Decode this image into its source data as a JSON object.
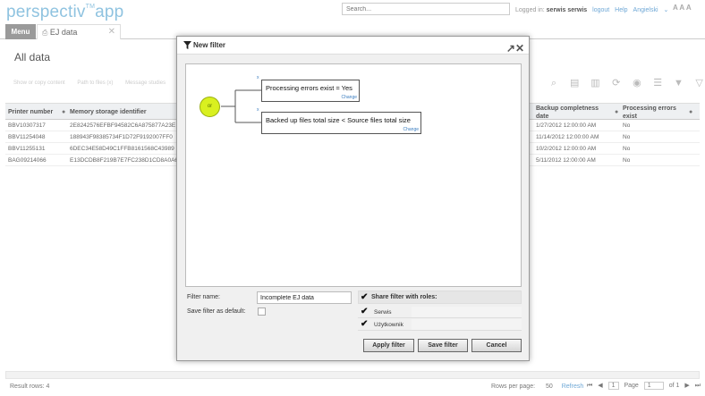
{
  "header": {
    "logo_text": "perspectiv",
    "logo_tm": "TM",
    "logo_app": "app",
    "search_placeholder": "Search...",
    "logged_in_label": "Logged in:",
    "user": "serwis serwis",
    "logout": "logout",
    "help": "Help",
    "language": "Angielski",
    "font_sizes": "A A A"
  },
  "tabs": {
    "menu_label": "Menu",
    "ej_tab_label": "EJ data",
    "close_glyph": "✕"
  },
  "page": {
    "title": "All data",
    "toolbar_links": [
      "Show or copy content",
      "Path to files (x)",
      "Message studies"
    ]
  },
  "grid": {
    "columns": [
      "Printer number",
      "Memory storage identifier",
      "Backup completness date",
      "Processing errors exist"
    ],
    "rows": [
      {
        "printer": "BBV10307317",
        "memory": "2E8242576EFBF94582C6A875877A23E",
        "date": "1/27/2012 12:00:00 AM",
        "errors": "No"
      },
      {
        "printer": "BBV11254048",
        "memory": "188943F98385734F1D72F9192007FF0",
        "date": "11/14/2012 12:00:00 AM",
        "errors": "No"
      },
      {
        "printer": "BBV11255131",
        "memory": "6DEC34E58D49C1FFB8161568C43989",
        "date": "10/2/2012 12:00:00 AM",
        "errors": "No"
      },
      {
        "printer": "BAG09214066",
        "memory": "E13DCDB8F219B7E7FC238D1CD8A0A6",
        "date": "5/11/2012 12:00:00 AM",
        "errors": "No"
      }
    ]
  },
  "footer": {
    "result_rows": "Result rows: 4",
    "rows_per_page_label": "Rows per page:",
    "rows_per_page_value": "50",
    "refresh": "Refresh",
    "current_page": "1",
    "page_label": "Page",
    "page_input": "1",
    "of_pages": "of 1"
  },
  "modal": {
    "title": "New filter",
    "or_label": "or",
    "condition1": "Processing errors exist = Yes",
    "condition2": "Backed up files total size < Source files total size",
    "change_label": "Change",
    "remove_glyph": "x",
    "filter_name_label": "Filter name:",
    "filter_name_value": "Incomplete EJ data",
    "save_default_label": "Save filter as default:",
    "share_roles_label": "Share filter with roles:",
    "roles": [
      "Serwis",
      "Użytkownik"
    ],
    "apply_button": "Apply filter",
    "save_button": "Save filter",
    "cancel_button": "Cancel"
  },
  "colors": {
    "logo": "#8fc3e0",
    "or_node": "#d9f020",
    "link": "#3a7dc0"
  }
}
